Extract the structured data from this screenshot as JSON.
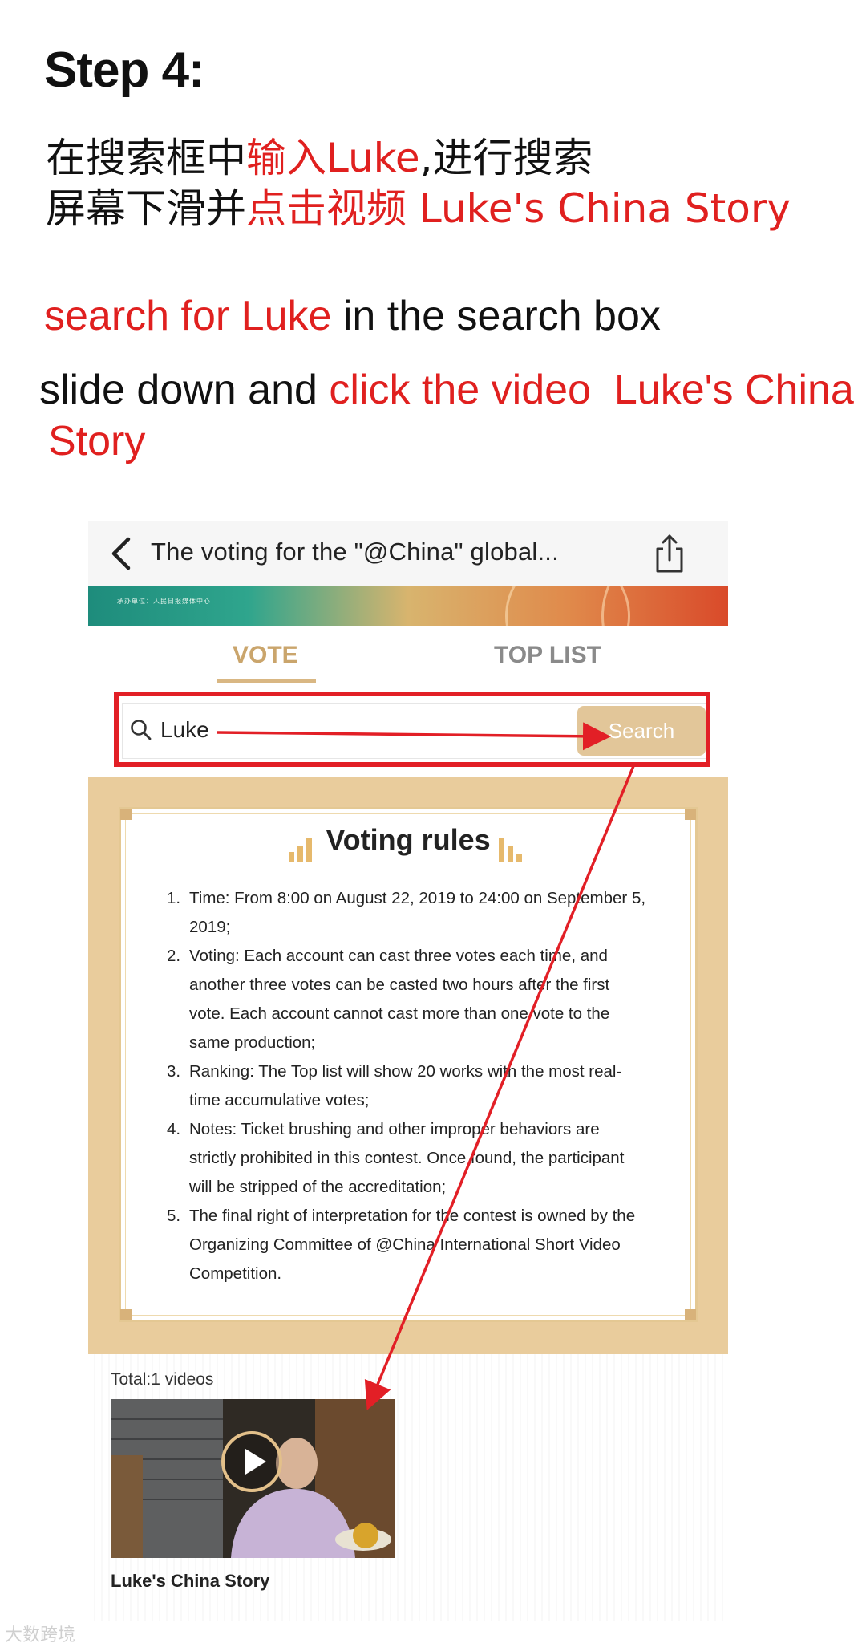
{
  "step": {
    "title": "Step 4:"
  },
  "instructions": {
    "cn_line1": {
      "part1": "在搜索框中",
      "part2_highlight": "输入Luke",
      "part3": ",进行搜索"
    },
    "cn_line2": {
      "part1": "屏幕下滑并",
      "part2_highlight": "点击视频 Luke's China Story"
    },
    "en_line1": {
      "part1_highlight": "search for Luke",
      "part2": " in the search box"
    },
    "en_line2": {
      "part1": "slide down and ",
      "part2_highlight": "click the video  Luke's China"
    },
    "en_line3": {
      "part1_highlight": "Story"
    }
  },
  "phone": {
    "header": {
      "back_icon": "chevron-left-icon",
      "title": "The voting for the \"@China\" global...",
      "share_icon": "share-icon"
    },
    "banner": {
      "small_text": "承办单位：人民日报媒体中心"
    },
    "tabs": [
      {
        "label": "VOTE",
        "active": true
      },
      {
        "label": "TOP LIST",
        "active": false
      }
    ],
    "search": {
      "icon": "search-icon",
      "value": "Luke",
      "button_label": "Search"
    },
    "rules": {
      "title": "Voting rules",
      "items": [
        {
          "num": "1.",
          "text": "Time: From 8:00 on August 22, 2019 to 24:00 on September 5, 2019;"
        },
        {
          "num": "2.",
          "text": "Voting: Each account can cast three votes each time, and another three votes can be casted two hours after the first vote. Each account cannot cast more than one vote to the same production;"
        },
        {
          "num": "3.",
          "text": "Ranking: The Top list will show 20 works with the most real-time accumulative votes;"
        },
        {
          "num": "4.",
          "text": "Notes: Ticket brushing and other improper behaviors are strictly prohibited in this contest. Once found, the participant will be stripped of the accreditation;"
        },
        {
          "num": "5.",
          "text": "The final right of interpretation for the contest is owned by the Organizing Committee of @China International Short Video Competition."
        }
      ]
    },
    "results": {
      "total_label": "Total:1 videos",
      "video": {
        "title": "Luke's China Story",
        "play_icon": "play-icon"
      }
    }
  },
  "watermark": "大数跨境",
  "colors": {
    "highlight_red": "#e0201f",
    "gold_accent": "#e2c699",
    "tab_inactive": "#8a8a8a",
    "annotation_red": "#e21f26"
  }
}
